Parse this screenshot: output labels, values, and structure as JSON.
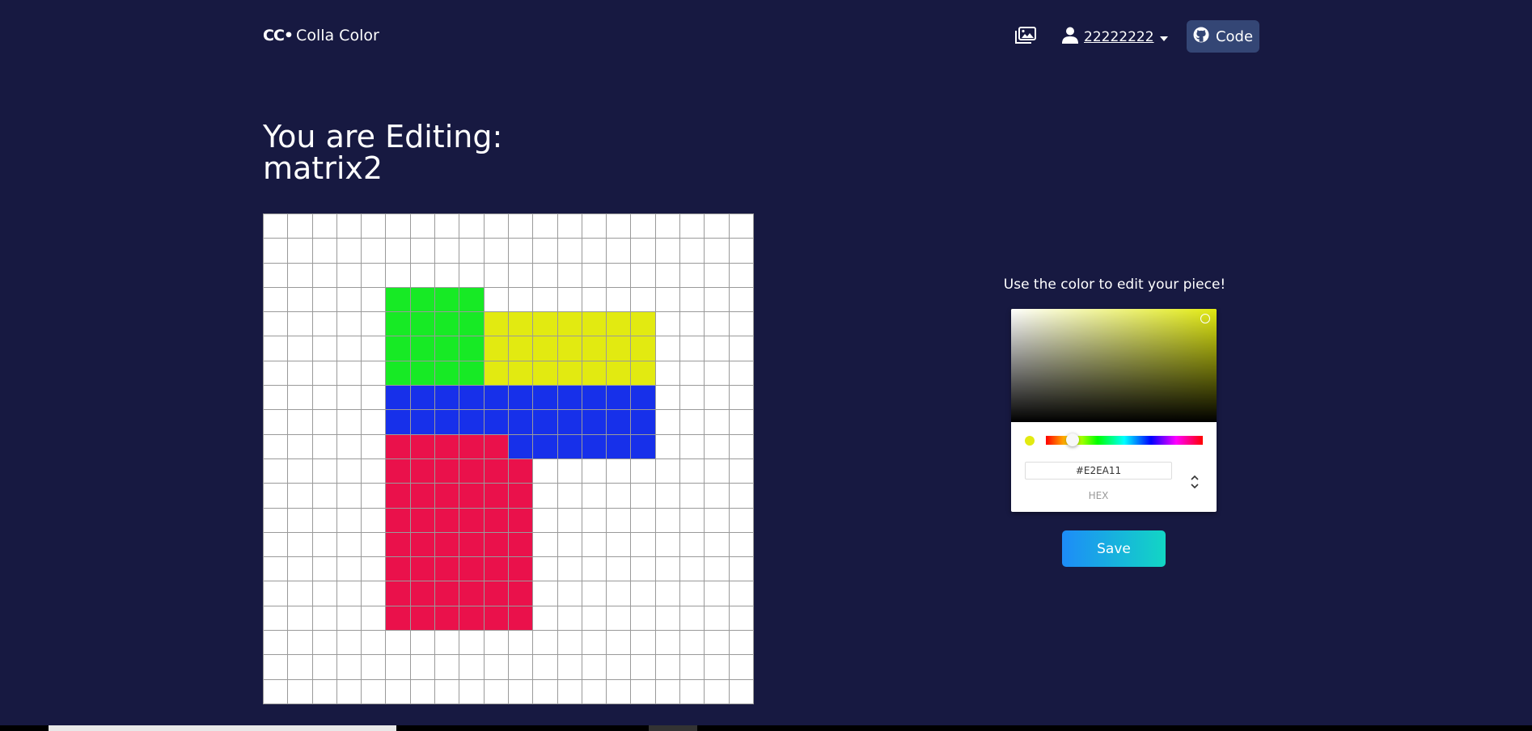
{
  "nav": {
    "logo_mark": "CC•",
    "logo_text": "Colla Color",
    "username": "22222222",
    "code_label": "Code"
  },
  "heading": {
    "line1": "You are Editing:",
    "line2": "matrix2"
  },
  "grid": {
    "rows": 20,
    "cols": 20,
    "default_color": "#ffffff",
    "regions": [
      {
        "name": "green",
        "color": "#17ea25",
        "row_start": 3,
        "row_end": 6,
        "col_start": 5,
        "col_end": 8
      },
      {
        "name": "yellow",
        "color": "#e2ea11",
        "row_start": 4,
        "row_end": 6,
        "col_start": 9,
        "col_end": 15
      },
      {
        "name": "blue",
        "color": "#1730ea",
        "row_start": 7,
        "row_end": 8,
        "col_start": 5,
        "col_end": 15
      },
      {
        "name": "blue",
        "color": "#1730ea",
        "row_start": 9,
        "row_end": 9,
        "col_start": 10,
        "col_end": 15
      },
      {
        "name": "red",
        "color": "#ea114b",
        "row_start": 9,
        "row_end": 9,
        "col_start": 5,
        "col_end": 9
      },
      {
        "name": "red",
        "color": "#ea114b",
        "row_start": 10,
        "row_end": 16,
        "col_start": 5,
        "col_end": 10
      }
    ]
  },
  "picker": {
    "hint": "Use the color to edit your piece!",
    "hex_value": "#E2EA11",
    "mode_label": "HEX",
    "current_color": "#e2ea11",
    "hue_fraction": 0.17
  },
  "save_label": "Save"
}
